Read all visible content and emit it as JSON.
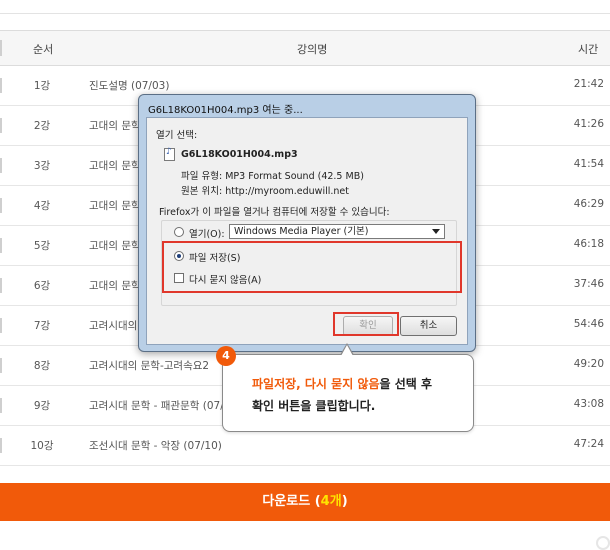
{
  "table": {
    "headers": {
      "num": "순서",
      "title": "강의명",
      "time": "시간"
    },
    "rows": [
      {
        "num": "1강",
        "title": "진도설명 (07/03)",
        "time": "21:42"
      },
      {
        "num": "2강",
        "title": "고대의 문학",
        "time": "41:26"
      },
      {
        "num": "3강",
        "title": "고대의 문학",
        "time": "41:54"
      },
      {
        "num": "4강",
        "title": "고대의 문학",
        "time": "46:29"
      },
      {
        "num": "5강",
        "title": "고대의 문학",
        "time": "46:18"
      },
      {
        "num": "6강",
        "title": "고대의 문학",
        "time": "37:46"
      },
      {
        "num": "7강",
        "title": "고려시대의",
        "time": "54:46"
      },
      {
        "num": "8강",
        "title": "고려시대의 문학-고려속요2",
        "time": "49:20"
      },
      {
        "num": "9강",
        "title": "고려시대 문학 - 패관문학 (07/1",
        "time": "43:08"
      },
      {
        "num": "10강",
        "title": "조선시대 문학 - 악장 (07/10)",
        "time": "47:24"
      }
    ]
  },
  "download": {
    "label": "다운로드 (",
    "count": "4개",
    "close": ")"
  },
  "dialog": {
    "title": "G6L18KO01H004.mp3 여는 중...",
    "open_with_label": "열기 선택:",
    "filename": "G6L18KO01H004.mp3",
    "file_type": "파일 유형: MP3 Format Sound (42.5 MB)",
    "source": "원본 위치: http://myroom.eduwill.net",
    "question": "Firefox가 이 파일을 열거나 컴퓨터에 저장할 수 있습니다:",
    "open_option": "열기(O):",
    "app_value": "Windows Media Player (기본)",
    "save_option": "파일 저장(S)",
    "dont_ask": "다시 묻지 않음(A)",
    "ok": "확인",
    "cancel": "취소"
  },
  "callout": {
    "step": "4",
    "highlight": "파일저장, 다시 묻지 않음",
    "line1_rest": "을 선택 후",
    "line2": "확인 버튼을 클립합니다."
  },
  "colors": {
    "accent": "#f15a0a",
    "highlight_box": "#e0372b",
    "count": "#ffe400"
  }
}
